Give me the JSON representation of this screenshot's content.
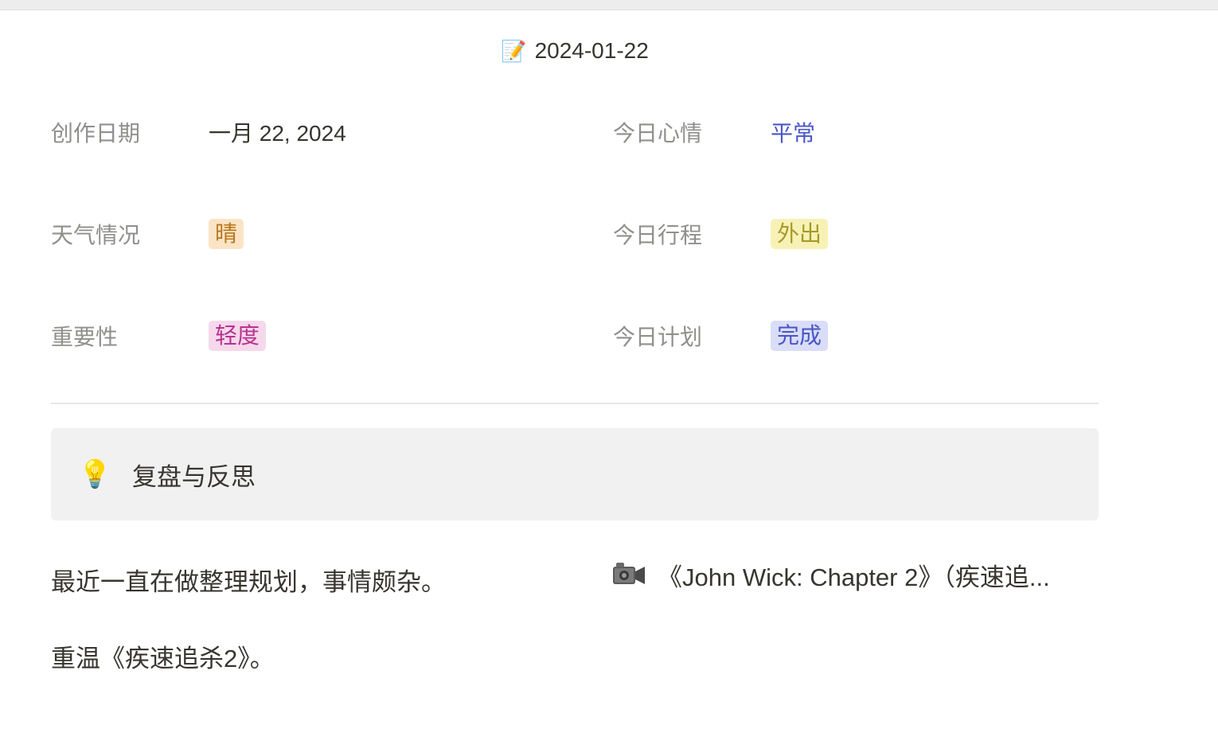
{
  "page": {
    "title_icon": "memo-icon",
    "title": "2024-01-22"
  },
  "properties": {
    "created_date": {
      "label": "创作日期",
      "value": "一月 22, 2024"
    },
    "mood": {
      "label": "今日心情",
      "value": "平常",
      "color": "#4a57c9"
    },
    "weather": {
      "label": "天气情况",
      "value": "晴",
      "tag_color": "orange"
    },
    "schedule": {
      "label": "今日行程",
      "value": "外出",
      "tag_color": "yellow"
    },
    "importance": {
      "label": "重要性",
      "value": "轻度",
      "tag_color": "pink"
    },
    "plan": {
      "label": "今日计划",
      "value": "完成",
      "tag_color": "blue"
    }
  },
  "callout": {
    "icon": "lightbulb-icon",
    "text": "复盘与反思"
  },
  "body": {
    "paragraph_1": "最近一直在做整理规划，事情颇杂。",
    "paragraph_2": "重温《疾速追杀2》。",
    "linked_page": {
      "icon": "video-camera-icon",
      "title": "《John Wick: Chapter 2》（疾速追..."
    }
  }
}
